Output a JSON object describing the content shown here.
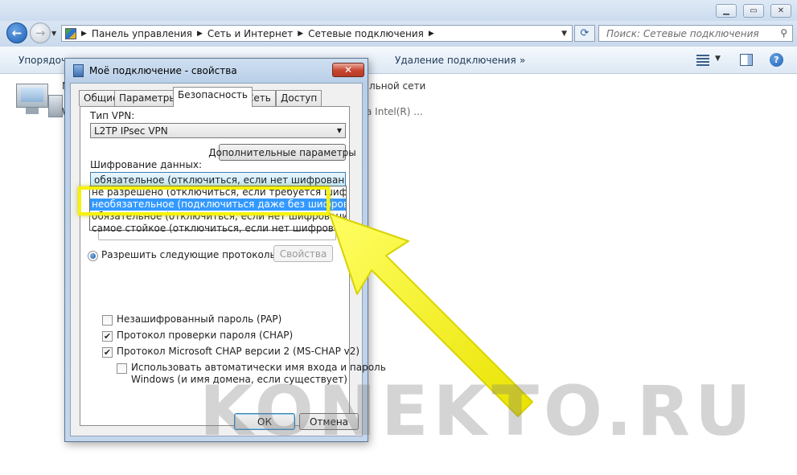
{
  "explorer": {
    "breadcrumbs": [
      "Панель управления",
      "Сеть и Интернет",
      "Сетевые подключения"
    ],
    "search_placeholder": "Поиск: Сетевые подключения",
    "toolbar": {
      "organize": "Упорядочи",
      "delete_connection": "Удаление подключения",
      "more": "»"
    },
    "network_item": {
      "name_fragment": "М",
      "detail_fragment": "W",
      "status_fragment": "льной сети",
      "adapter_fragment": "а Intel(R) ..."
    }
  },
  "dialog": {
    "title": "Моё подключение - свойства",
    "close": "✕",
    "tabs": [
      "Общие",
      "Параметры",
      "Безопасность",
      "Сеть",
      "Доступ"
    ],
    "active_tab": "Безопасность",
    "vpn_type_label": "Тип VPN:",
    "vpn_type_value": "L2TP IPsec VPN",
    "advanced_button": "Дополнительные параметры",
    "encryption_label": "Шифрование данных:",
    "encryption_value": "обязательное (отключиться, если нет шифрования)",
    "encryption_options": [
      "не разрешено (отключиться, если требуется шифрование)",
      "необязательное (подключиться даже без шифрования)",
      "обязательное (отключиться, если нет шифрования)",
      "самое стойкое (отключиться, если нет шифрования)"
    ],
    "selected_option": "необязательное (подключиться даже без шифрования)",
    "allow_protocols_label": "Разрешить следующие протоколы",
    "properties_button": "Свойства",
    "checkboxes": [
      {
        "label": "Незашифрованный пароль (PAP)",
        "checked": false
      },
      {
        "label": "Протокол проверки пароля (CHAP)",
        "checked": true
      },
      {
        "label": "Протокол Microsoft CHAP версии 2 (MS-CHAP v2)",
        "checked": true
      }
    ],
    "auto_logon_line1": "Использовать автоматически имя входа и пароль",
    "auto_logon_line2": "Windows (и имя домена, если существует)",
    "auto_logon_checked": false,
    "ok_button": "ОК",
    "cancel_button": "Отмена"
  },
  "annotation": {
    "highlight_color": "#f6f20a",
    "arrow_color": "#f6f20a"
  },
  "watermark": "KONEKTO.RU"
}
